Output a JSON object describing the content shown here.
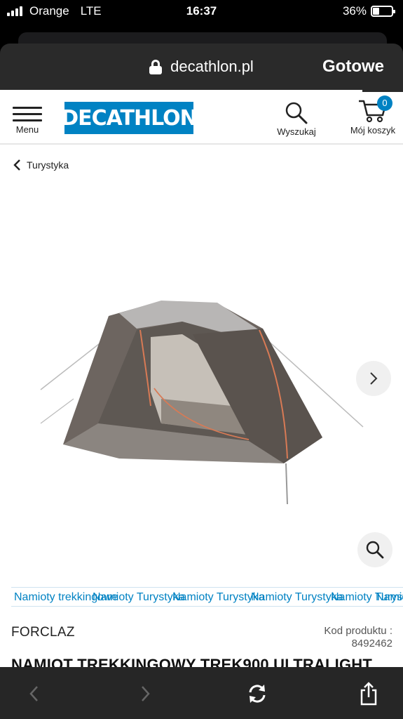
{
  "status_bar": {
    "carrier": "Orange",
    "network": "LTE",
    "time": "16:37",
    "battery_percent_text": "36%",
    "battery_level": 0.36
  },
  "browser": {
    "domain": "decathlon.pl",
    "done_label": "Gotowe"
  },
  "site_header": {
    "menu_label": "Menu",
    "logo_text": "DECATHLON",
    "search_label": "Wyszukaj",
    "cart_label": "Mój koszyk",
    "cart_count": "0"
  },
  "breadcrumb": {
    "label": "Turystyka"
  },
  "thumbnails": [
    "Namioty trekkingowe",
    "Namioty Turystyka",
    "Namioty Turystyka",
    "Namioty Turystyka",
    "Namioty Turystyka",
    "Namioty Turystyka"
  ],
  "product": {
    "brand": "FORCLAZ",
    "code_label": "Kod produktu :",
    "code_value": "8492462",
    "title": "NAMIOT TREKKINGOWY TREK900 ULTRALIGHT"
  },
  "colors": {
    "brand_blue": "#0082c3",
    "toolbar": "#262626"
  },
  "icons": {
    "lock": "lock-icon",
    "menu": "hamburger-icon",
    "search": "magnifier-icon",
    "cart": "cart-icon",
    "back": "chevron-left-icon",
    "next": "chevron-right-icon",
    "zoom": "magnifier-icon",
    "reload": "reload-icon",
    "share": "share-icon"
  }
}
